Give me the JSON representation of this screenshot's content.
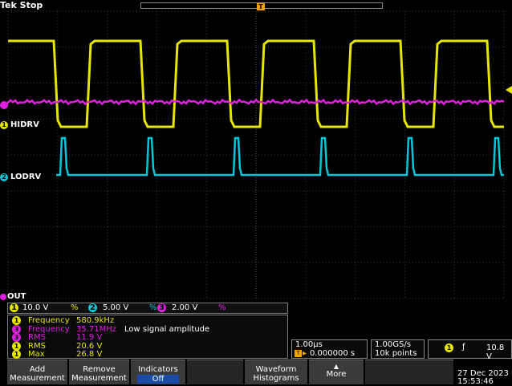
{
  "header": {
    "brand": "Tek Stop",
    "trigger_marker": "T"
  },
  "channels": {
    "ch1_label": "HIDRV",
    "ch2_label": "LODRV",
    "ch1_num": "1",
    "ch2_num": "2",
    "ref_label": "OUT",
    "colors": {
      "ch1": "#e6e600",
      "ch2": "#00c8d8",
      "ch3": "#e020e0"
    }
  },
  "settings_bar": {
    "ch1_num": "1",
    "ch1_scale": "10.0 V",
    "ch2_num": "2",
    "ch2_scale": "5.00 V",
    "ch3_num": "3",
    "ch3_scale": "2.00 V",
    "bw_glyph": "%"
  },
  "measurements": [
    {
      "ch": "1",
      "label": "Frequency",
      "value": "580.9kHz",
      "note": "",
      "color": "#e6e600"
    },
    {
      "ch": "3",
      "label": "Frequency",
      "value": "35.71MHz",
      "note": "Low signal amplitude",
      "color": "#e020e0"
    },
    {
      "ch": "3",
      "label": "RMS",
      "value": "11.9 V",
      "note": "",
      "color": "#e020e0"
    },
    {
      "ch": "1",
      "label": "RMS",
      "value": "20.6 V",
      "note": "",
      "color": "#e6e600"
    },
    {
      "ch": "1",
      "label": "Max",
      "value": "26.8 V",
      "note": "",
      "color": "#e6e600"
    }
  ],
  "horizontal": {
    "scale": "1.00µs",
    "delay": "0.000000 s"
  },
  "acquisition": {
    "rate": "1.00GS/s",
    "points": "10k points"
  },
  "trigger": {
    "ch": "1",
    "level": "10.8 V"
  },
  "menu": {
    "add": "Add Measurement",
    "remove": "Remove Measurement",
    "indicators": "Indicators",
    "indicators_state": "Off",
    "waveform": "Waveform Histograms",
    "more": "More"
  },
  "datetime": {
    "date": "27 Dec 2023",
    "time": "15:53:46"
  }
}
